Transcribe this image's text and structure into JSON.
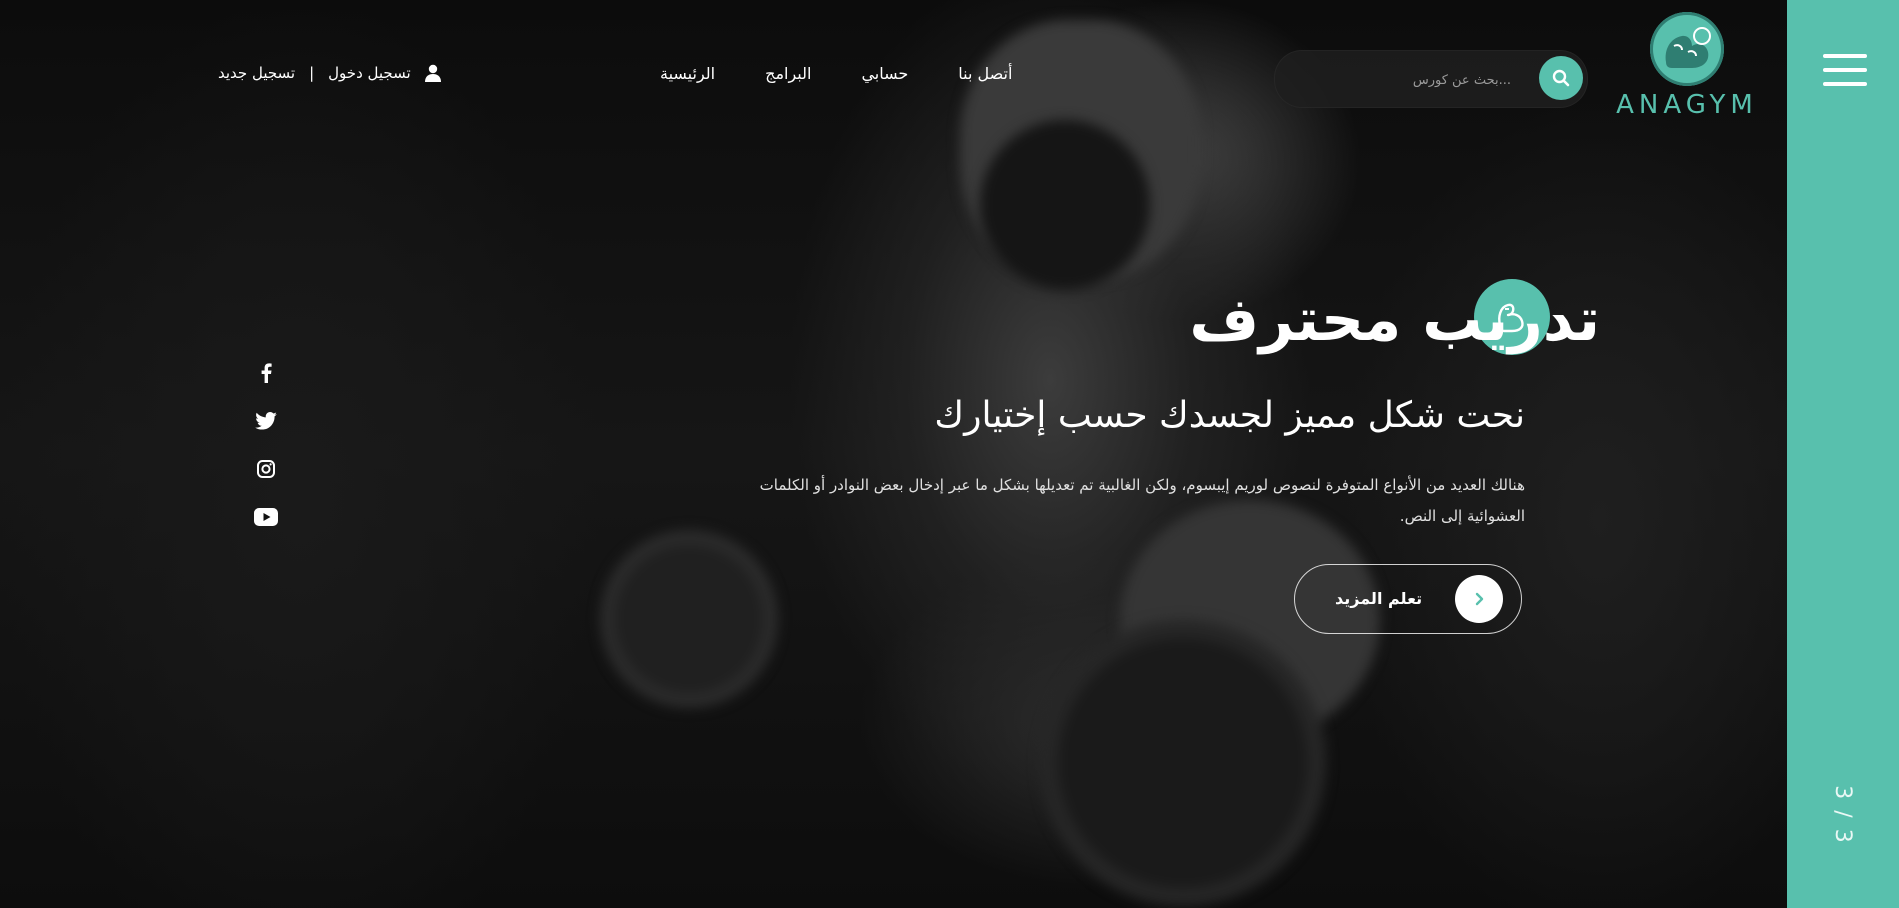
{
  "brand": {
    "name": "ANAGYM"
  },
  "search": {
    "placeholder": "...بحث عن كورس",
    "icon": "search-icon"
  },
  "nav": {
    "items": [
      {
        "label": "الرئيسية"
      },
      {
        "label": "البرامج"
      },
      {
        "label": "حسابي"
      },
      {
        "label": "أتصل بنا"
      }
    ]
  },
  "auth": {
    "login_label": "تسجيل دخول",
    "separator": "|",
    "register_label": "تسجيل جديد",
    "icon": "user-icon"
  },
  "social": [
    "facebook-icon",
    "twitter-icon",
    "instagram-icon",
    "youtube-icon"
  ],
  "hero": {
    "title": "تدريب محترف",
    "subtitle": "نحت شكل مميز لجسدك حسب إختيارك",
    "description": "هنالك العديد من الأنواع المتوفرة لنصوص لوريم إيبسوم، ولكن الغالبية تم تعديلها بشكل ما عبر إدخال بعض النوادر أو الكلمات العشوائية إلى النص.",
    "cta_label": "تعلم المزيد",
    "badge_icon": "muscle-icon"
  },
  "slider": {
    "pager": "3 / 3"
  },
  "colors": {
    "accent": "#58c0ad",
    "background": "#111111"
  }
}
